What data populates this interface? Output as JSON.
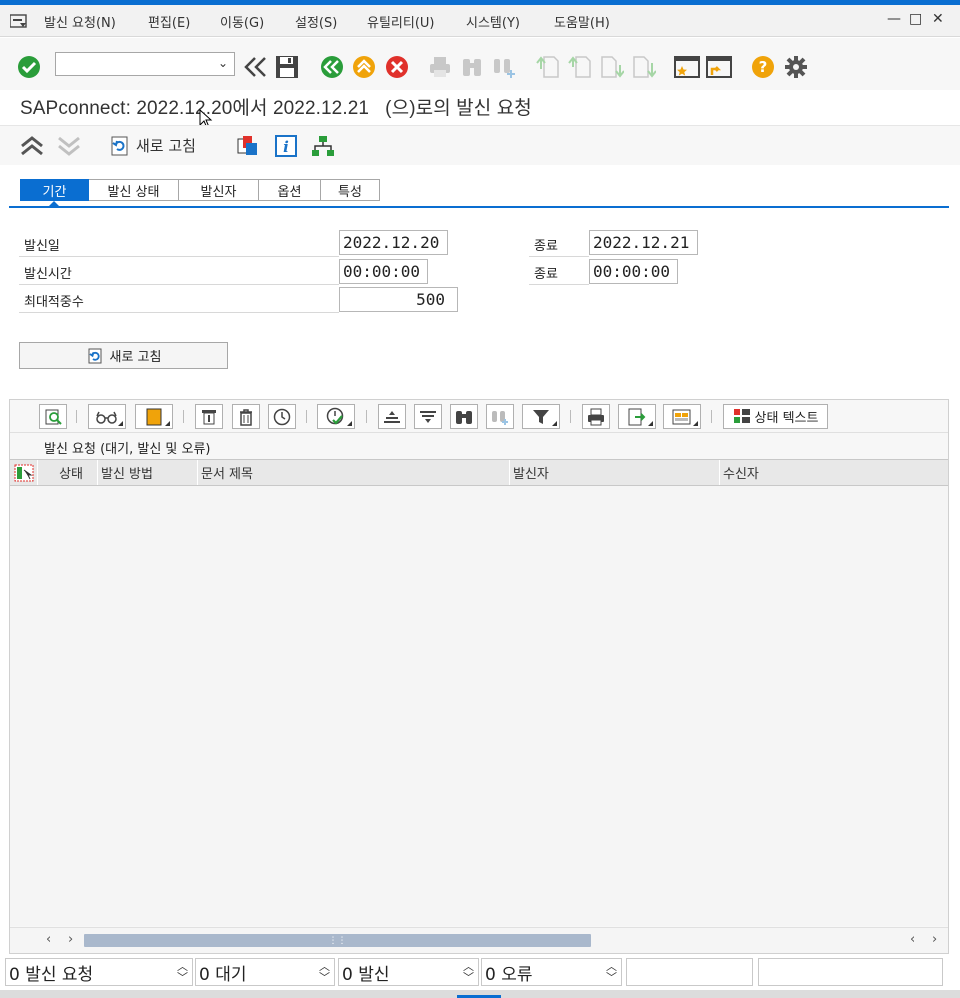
{
  "menubar": {
    "items": [
      "발신 요청(N)",
      "편집(E)",
      "이동(G)",
      "설정(S)",
      "유틸리티(U)",
      "시스템(Y)",
      "도움말(H)"
    ]
  },
  "window_controls": {
    "minimize": "—",
    "maximize": "□",
    "close": "✕"
  },
  "toolbar": {
    "command_field": {
      "value": "",
      "placeholder": ""
    }
  },
  "title": "SAPconnect: 2022.12.20에서 2022.12.21   (으)로의 발신 요청",
  "app_toolbar": {
    "refresh_label": "새로 고침"
  },
  "tabs": [
    {
      "label": "기간",
      "active": true
    },
    {
      "label": "발신 상태",
      "active": false
    },
    {
      "label": "발신자",
      "active": false
    },
    {
      "label": "옵션",
      "active": false
    },
    {
      "label": "특성",
      "active": false
    }
  ],
  "form": {
    "send_date": {
      "label": "발신일",
      "value": "2022.12.20",
      "to_label": "종료",
      "to_value": "2022.12.21"
    },
    "send_time": {
      "label": "발신시간",
      "value": "00:00:00",
      "to_label": "종료",
      "to_value": "00:00:00"
    },
    "max_hits": {
      "label": "최대적중수",
      "value": "500"
    },
    "refresh_button": "새로 고침"
  },
  "grid": {
    "toolbar_text_button": "상태 텍스트",
    "title": "발신 요청 (대기, 발신 및 오류)",
    "columns": [
      "상태",
      "발신 방법",
      "문서 제목",
      "발신자",
      "수신자"
    ],
    "rows": []
  },
  "statusbar": {
    "fields": [
      "0 발신 요청",
      "0 대기",
      "0 발신",
      "0 오류",
      "",
      ""
    ]
  },
  "colors": {
    "accent": "#0a6ed1",
    "ok_green": "#2a9d3a",
    "nav_green": "#2a9d3a",
    "orange": "#f0a30a",
    "cancel_red": "#e0312b"
  }
}
